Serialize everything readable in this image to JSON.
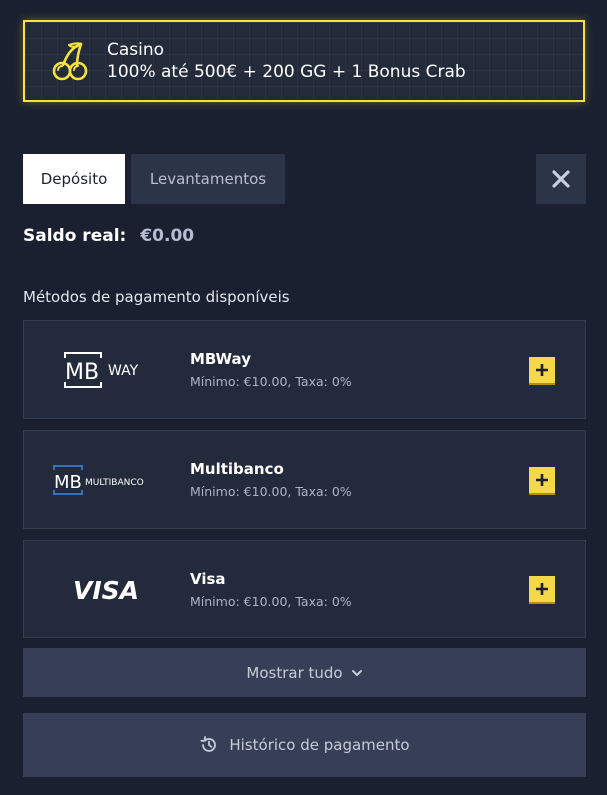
{
  "promo": {
    "title": "Casino",
    "offer": "100% até 500€ + 200 GG + 1 Bonus Crab",
    "icon": "cherries-icon",
    "accent_color": "#f7e23a"
  },
  "tabs": [
    {
      "label": "Depósito",
      "active": true
    },
    {
      "label": "Levantamentos",
      "active": false
    }
  ],
  "close_icon": "close-icon",
  "balance": {
    "label": "Saldo real:",
    "value": "€0.00"
  },
  "methods_heading": "Métodos de pagamento disponíveis",
  "methods": [
    {
      "name": "MBWay",
      "desc": "Mínimo: €10.00, Taxa: 0%",
      "logo": "mbway-logo",
      "logo_text": "WAY"
    },
    {
      "name": "Multibanco",
      "desc": "Mínimo: €10.00, Taxa: 0%",
      "logo": "multibanco-logo",
      "logo_text": "MULTIBANCO"
    },
    {
      "name": "Visa",
      "desc": "Mínimo: €10.00, Taxa: 0%",
      "logo": "visa-logo",
      "logo_text": "VISA"
    }
  ],
  "show_all": {
    "label": "Mostrar tudo",
    "icon": "chevron-down-icon"
  },
  "history": {
    "label": "Histórico de pagamento",
    "icon": "history-icon"
  },
  "colors": {
    "background": "#1a2030",
    "card": "#232a3b",
    "button": "#363f56",
    "add_button": "#f5d84a"
  }
}
